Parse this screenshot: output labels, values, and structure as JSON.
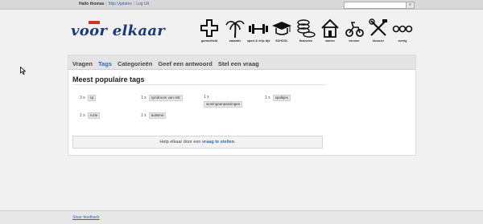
{
  "topbar": {
    "greeting": "Hallo thomas",
    "links": [
      "Mijn Updates",
      "Log Uit"
    ],
    "search_placeholder": "",
    "search_icon": "magnifier-icon"
  },
  "logo": {
    "text": "voor elkaar",
    "tag": ""
  },
  "categories": [
    {
      "label": "gezondheid",
      "icon": "cross-icon"
    },
    {
      "label": "vakantie",
      "icon": "palm-tree-icon"
    },
    {
      "label": "sport & vrije tijd",
      "icon": "dumbbell-icon"
    },
    {
      "label": "SCHOOL",
      "icon": "graduation-cap-icon"
    },
    {
      "label": "financien",
      "icon": "coins-icon"
    },
    {
      "label": "wonen",
      "icon": "house-icon"
    },
    {
      "label": "vervoer",
      "icon": "scooter-icon"
    },
    {
      "label": "klussen",
      "icon": "tools-icon"
    },
    {
      "label": "overig",
      "icon": "dots-icon"
    }
  ],
  "tabs": [
    {
      "label": "Vragen"
    },
    {
      "label": "Tags"
    },
    {
      "label": "Categorieën"
    },
    {
      "label": "Geef een antwoord"
    },
    {
      "label": "Stel een vraag"
    }
  ],
  "active_tab": "Tags",
  "heading": "Meest populaire tags",
  "tags": [
    {
      "count": "3 x",
      "name": "cp"
    },
    {
      "count": "1 x",
      "name": "syndroom van rett"
    },
    {
      "count": "1 x",
      "name": "woningaanpassingen"
    },
    {
      "count": "1 x",
      "name": "spalkjes"
    },
    {
      "count": "1 x",
      "name": "ruzie"
    },
    {
      "count": "1 x",
      "name": "autisme"
    }
  ],
  "help": {
    "prefix": "Help elkaar door een",
    "link": "vraag te stellen",
    "suffix": "."
  },
  "footer": {
    "link": "Stuur feedback"
  }
}
